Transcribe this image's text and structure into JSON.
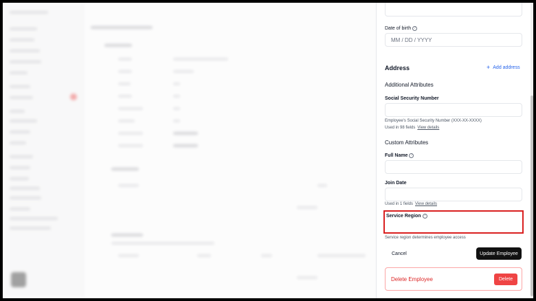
{
  "panel": {
    "dob": {
      "label": "Date of birth",
      "placeholder": "MM / DD / YYYY"
    },
    "address": {
      "title": "Address",
      "add_label": "Add address"
    },
    "additional": {
      "title": "Additional Attributes",
      "ssn": {
        "label": "Social Security Number",
        "helper": "Employee's Social Security Number (XXX-XX-XXXX)",
        "usage": "Used in 98 fields",
        "link": "View details"
      }
    },
    "custom": {
      "title": "Custom Attributes",
      "full_name_label": "Full Name",
      "join_date": {
        "label": "Join Date",
        "usage": "Used in 1 fields",
        "link": "View details"
      },
      "service_region": {
        "label": "Service Region",
        "helper": "Service region determines employee access"
      }
    },
    "actions": {
      "cancel": "Cancel",
      "update": "Update Employee"
    },
    "danger": {
      "text": "Delete Employee",
      "button": "Delete"
    }
  },
  "colors": {
    "accent": "#2563eb",
    "danger": "#dc2626",
    "highlight": "#d91e1e",
    "primary_button": "#111111"
  },
  "icons": [
    "help-circle-icon",
    "plus-icon"
  ]
}
